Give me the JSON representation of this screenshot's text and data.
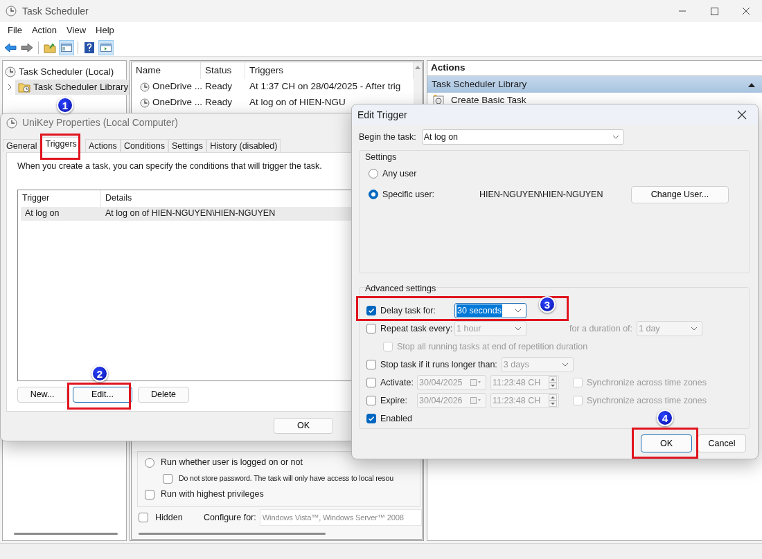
{
  "window": {
    "title": "Task Scheduler"
  },
  "menu": [
    "File",
    "Action",
    "View",
    "Help"
  ],
  "tree": [
    {
      "label": "Task Scheduler (Local)",
      "selected": false,
      "children": [
        {
          "label": "Task Scheduler Library",
          "selected": true,
          "expanded": false
        }
      ]
    }
  ],
  "task_list": {
    "columns": [
      "Name",
      "Status",
      "Triggers"
    ],
    "rows": [
      {
        "cells": [
          "OneDrive ...",
          "Ready",
          "At 1:37 CH on 28/04/2025 - After trig"
        ]
      },
      {
        "cells": [
          "OneDrive ...",
          "Ready",
          "At log on of HIEN-NGU"
        ]
      }
    ]
  },
  "actions_pane": {
    "title": "Actions",
    "section": "Task Scheduler Library",
    "items": [
      "Create Basic Task"
    ]
  },
  "general_options": {
    "items": [
      {
        "kind": "radio",
        "label": "Run whether user is logged on or not",
        "checked": false,
        "children": [
          {
            "kind": "checkbox",
            "label": "Do not store password.  The task will only have access to local resou",
            "checked": false
          }
        ]
      },
      {
        "kind": "checkbox",
        "label": "Run with highest privileges",
        "checked": false
      }
    ],
    "hidden": {
      "label": "Hidden",
      "checked": false
    },
    "configure_label": "Configure for:",
    "configure_value": "Windows Vista™, Windows Server™ 2008"
  },
  "properties_dialog": {
    "title": "UniKey Properties (Local Computer)",
    "tabs": [
      {
        "label": "General",
        "selected": false
      },
      {
        "label": "Triggers",
        "selected": true
      },
      {
        "label": "Actions",
        "selected": false
      },
      {
        "label": "Conditions",
        "selected": false
      },
      {
        "label": "Settings",
        "selected": false
      },
      {
        "label": "History (disabled)",
        "selected": false
      }
    ],
    "description": "When you create a task, you can specify the conditions that will trigger the task.",
    "columns": [
      "Trigger",
      "Details"
    ],
    "rows": [
      {
        "cells": [
          "At log on",
          "At log on of HIEN-NGUYEN\\HIEN-NGUYEN"
        ],
        "selected": true
      }
    ],
    "buttons": [
      "New...",
      "Edit...",
      "Delete"
    ],
    "footer_buttons": [
      "OK"
    ]
  },
  "edit_trigger": {
    "title": "Edit Trigger",
    "begin_label": "Begin the task:",
    "begin_value": "At log on",
    "settings_label": "Settings",
    "user_options": [
      {
        "label": "Any user",
        "selected": false
      },
      {
        "label": "Specific user:",
        "selected": true
      }
    ],
    "user_value": "HIEN-NGUYEN\\HIEN-NGUYEN",
    "change_user": "Change User...",
    "advanced_label": "Advanced settings",
    "rows": [
      {
        "kind": "select",
        "label": "Delay task for:",
        "checked": true,
        "value": "30 seconds"
      },
      {
        "kind": "repeat",
        "label": "Repeat task every:",
        "checked": false,
        "value": "1 hour",
        "duration_label": "for a duration of:",
        "duration_value": "1 day"
      },
      {
        "kind": "sub_checkbox",
        "label": "Stop all running tasks at end of repetition duration",
        "checked": false
      },
      {
        "kind": "select",
        "label": "Stop task if it runs longer than:",
        "checked": false,
        "value": "3 days"
      },
      {
        "kind": "datetime",
        "label": "Activate:",
        "checked": false,
        "date": "30/04/2025",
        "time": "11:23:48 CH",
        "sync_label": "Synchronize across time zones",
        "sync_checked": false
      },
      {
        "kind": "datetime",
        "label": "Expire:",
        "checked": false,
        "date": "30/04/2026",
        "time": "11:23:48 CH",
        "sync_label": "Synchronize across time zones",
        "sync_checked": false
      },
      {
        "kind": "checkbox",
        "label": "Enabled",
        "checked": true
      }
    ],
    "buttons": [
      "OK",
      "Cancel"
    ]
  },
  "callouts": [
    "1",
    "2",
    "3",
    "4"
  ]
}
